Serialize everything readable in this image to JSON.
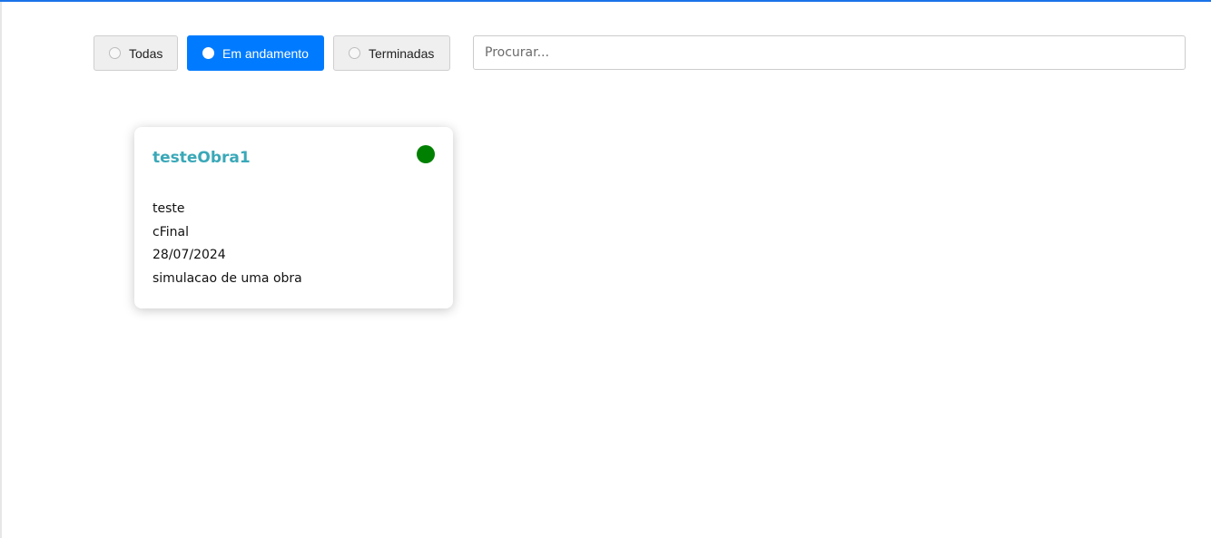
{
  "filters": {
    "options": [
      {
        "label": "Todas",
        "selected": false
      },
      {
        "label": "Em andamento",
        "selected": true
      },
      {
        "label": "Terminadas",
        "selected": false
      }
    ],
    "active_color": "#007bff"
  },
  "search": {
    "placeholder": "Procurar...",
    "value": ""
  },
  "obras": [
    {
      "title": "testeObra1",
      "status_color": "#008000",
      "lines": [
        "teste",
        "cFinal",
        "28/07/2024",
        "simulacao de uma obra"
      ]
    }
  ]
}
